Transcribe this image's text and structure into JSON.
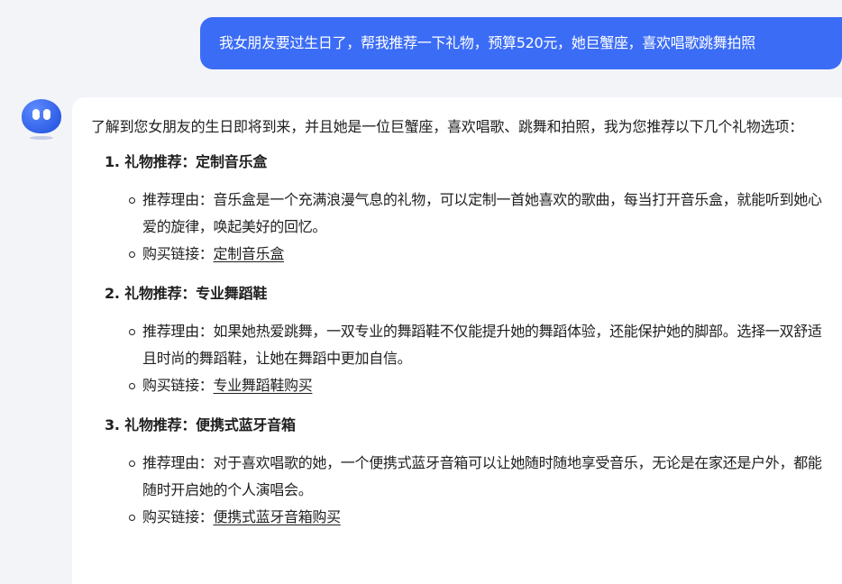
{
  "user_message": "我女朋友要过生日了，帮我推荐一下礼物，预算520元，她巨蟹座，喜欢唱歌跳舞拍照",
  "reply": {
    "intro": "了解到您女朋友的生日即将到来，并且她是一位巨蟹座，喜欢唱歌、跳舞和拍照，我为您推荐以下几个礼物选项：",
    "gifts": [
      {
        "title": "1. 礼物推荐：定制音乐盒",
        "reason": "推荐理由：音乐盒是一个充满浪漫气息的礼物，可以定制一首她喜欢的歌曲，每当打开音乐盒，就能听到她心爱的旋律，唤起美好的回忆。",
        "buy_label": "购买链接：",
        "buy_link": "定制音乐盒"
      },
      {
        "title": "2. 礼物推荐：专业舞蹈鞋",
        "reason": "推荐理由：如果她热爱跳舞，一双专业的舞蹈鞋不仅能提升她的舞蹈体验，还能保护她的脚部。选择一双舒适且时尚的舞蹈鞋，让她在舞蹈中更加自信。",
        "buy_label": "购买链接：",
        "buy_link": "专业舞蹈鞋购买"
      },
      {
        "title": "3. 礼物推荐：便携式蓝牙音箱",
        "reason": "推荐理由：对于喜欢唱歌的她，一个便携式蓝牙音箱可以让她随时随地享受音乐，无论是在家还是户外，都能随时开启她的个人演唱会。",
        "buy_label": "购买链接：",
        "buy_link": "便携式蓝牙音箱购买"
      }
    ]
  },
  "colors": {
    "user_bubble": "#3b6cf6",
    "page_background": "#f3f4f8",
    "reply_background": "#ffffff",
    "avatar": "#2f5fe6"
  },
  "icons": {
    "avatar": "robot-avatar-icon",
    "bullet": "hollow-circle-bullet-icon"
  }
}
